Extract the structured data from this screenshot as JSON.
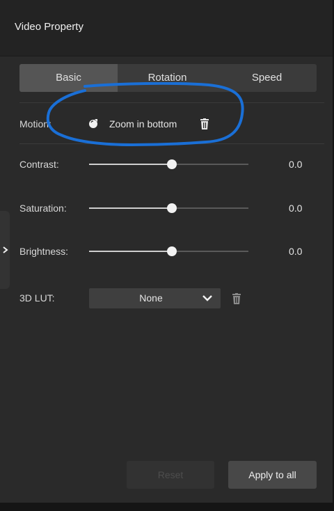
{
  "window": {
    "title": "Video Property"
  },
  "tabs": [
    {
      "label": "Basic",
      "active": true
    },
    {
      "label": "Rotation",
      "active": false
    },
    {
      "label": "Speed",
      "active": false
    }
  ],
  "motion": {
    "label": "Motion:",
    "value": "Zoom in bottom",
    "icon": "motion-icon"
  },
  "sliders": [
    {
      "label": "Contrast:",
      "value": "0.0",
      "level": 0.5
    },
    {
      "label": "Saturation:",
      "value": "0.0",
      "level": 0.5
    },
    {
      "label": "Brightness:",
      "value": "0.0",
      "level": 0.5
    }
  ],
  "lut": {
    "label": "3D LUT:",
    "selected": "None"
  },
  "buttons": {
    "reset": "Reset",
    "apply_all": "Apply to all"
  },
  "colors": {
    "annotation": "#1a6fd6",
    "panel": "#2a2a2a",
    "accent": "#f2f2f2"
  }
}
